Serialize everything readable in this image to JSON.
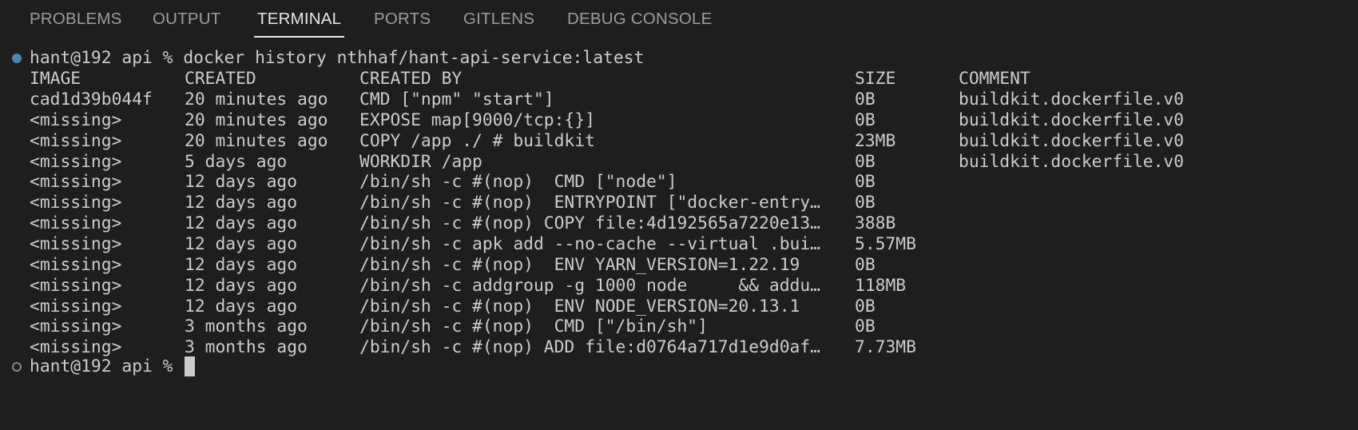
{
  "tabs": [
    {
      "label": "PROBLEMS",
      "active": false
    },
    {
      "label": "OUTPUT",
      "active": false
    },
    {
      "label": "TERMINAL",
      "active": true
    },
    {
      "label": "PORTS",
      "active": false
    },
    {
      "label": "GITLENS",
      "active": false
    },
    {
      "label": "DEBUG CONSOLE",
      "active": false
    }
  ],
  "terminal": {
    "command_line": "hant@192 api % docker history nthhaf/hant-api-service:latest",
    "headers": [
      "IMAGE",
      "CREATED",
      "CREATED BY",
      "SIZE",
      "COMMENT"
    ],
    "rows": [
      [
        "cad1d39b044f",
        "20 minutes ago",
        "CMD [\"npm\" \"start\"]",
        "0B",
        "buildkit.dockerfile.v0"
      ],
      [
        "<missing>",
        "20 minutes ago",
        "EXPOSE map[9000/tcp:{}]",
        "0B",
        "buildkit.dockerfile.v0"
      ],
      [
        "<missing>",
        "20 minutes ago",
        "COPY /app ./ # buildkit",
        "23MB",
        "buildkit.dockerfile.v0"
      ],
      [
        "<missing>",
        "5 days ago",
        "WORKDIR /app",
        "0B",
        "buildkit.dockerfile.v0"
      ],
      [
        "<missing>",
        "12 days ago",
        "/bin/sh -c #(nop)  CMD [\"node\"]",
        "0B",
        ""
      ],
      [
        "<missing>",
        "12 days ago",
        "/bin/sh -c #(nop)  ENTRYPOINT [\"docker-entry…",
        "0B",
        ""
      ],
      [
        "<missing>",
        "12 days ago",
        "/bin/sh -c #(nop) COPY file:4d192565a7220e13…",
        "388B",
        ""
      ],
      [
        "<missing>",
        "12 days ago",
        "/bin/sh -c apk add --no-cache --virtual .bui…",
        "5.57MB",
        ""
      ],
      [
        "<missing>",
        "12 days ago",
        "/bin/sh -c #(nop)  ENV YARN_VERSION=1.22.19",
        "0B",
        ""
      ],
      [
        "<missing>",
        "12 days ago",
        "/bin/sh -c addgroup -g 1000 node     && addu…",
        "118MB",
        ""
      ],
      [
        "<missing>",
        "12 days ago",
        "/bin/sh -c #(nop)  ENV NODE_VERSION=20.13.1",
        "0B",
        ""
      ],
      [
        "<missing>",
        "3 months ago",
        "/bin/sh -c #(nop)  CMD [\"/bin/sh\"]",
        "0B",
        ""
      ],
      [
        "<missing>",
        "3 months ago",
        "/bin/sh -c #(nop) ADD file:d0764a717d1e9d0af…",
        "7.73MB",
        ""
      ]
    ],
    "prompt_line": "hant@192 api % "
  },
  "colors": {
    "background": "#1e1e1e",
    "text": "#cccccc",
    "tab_inactive": "#9d9d9d",
    "tab_active": "#e7e7e7",
    "decoration_success": "#4a89b8"
  }
}
